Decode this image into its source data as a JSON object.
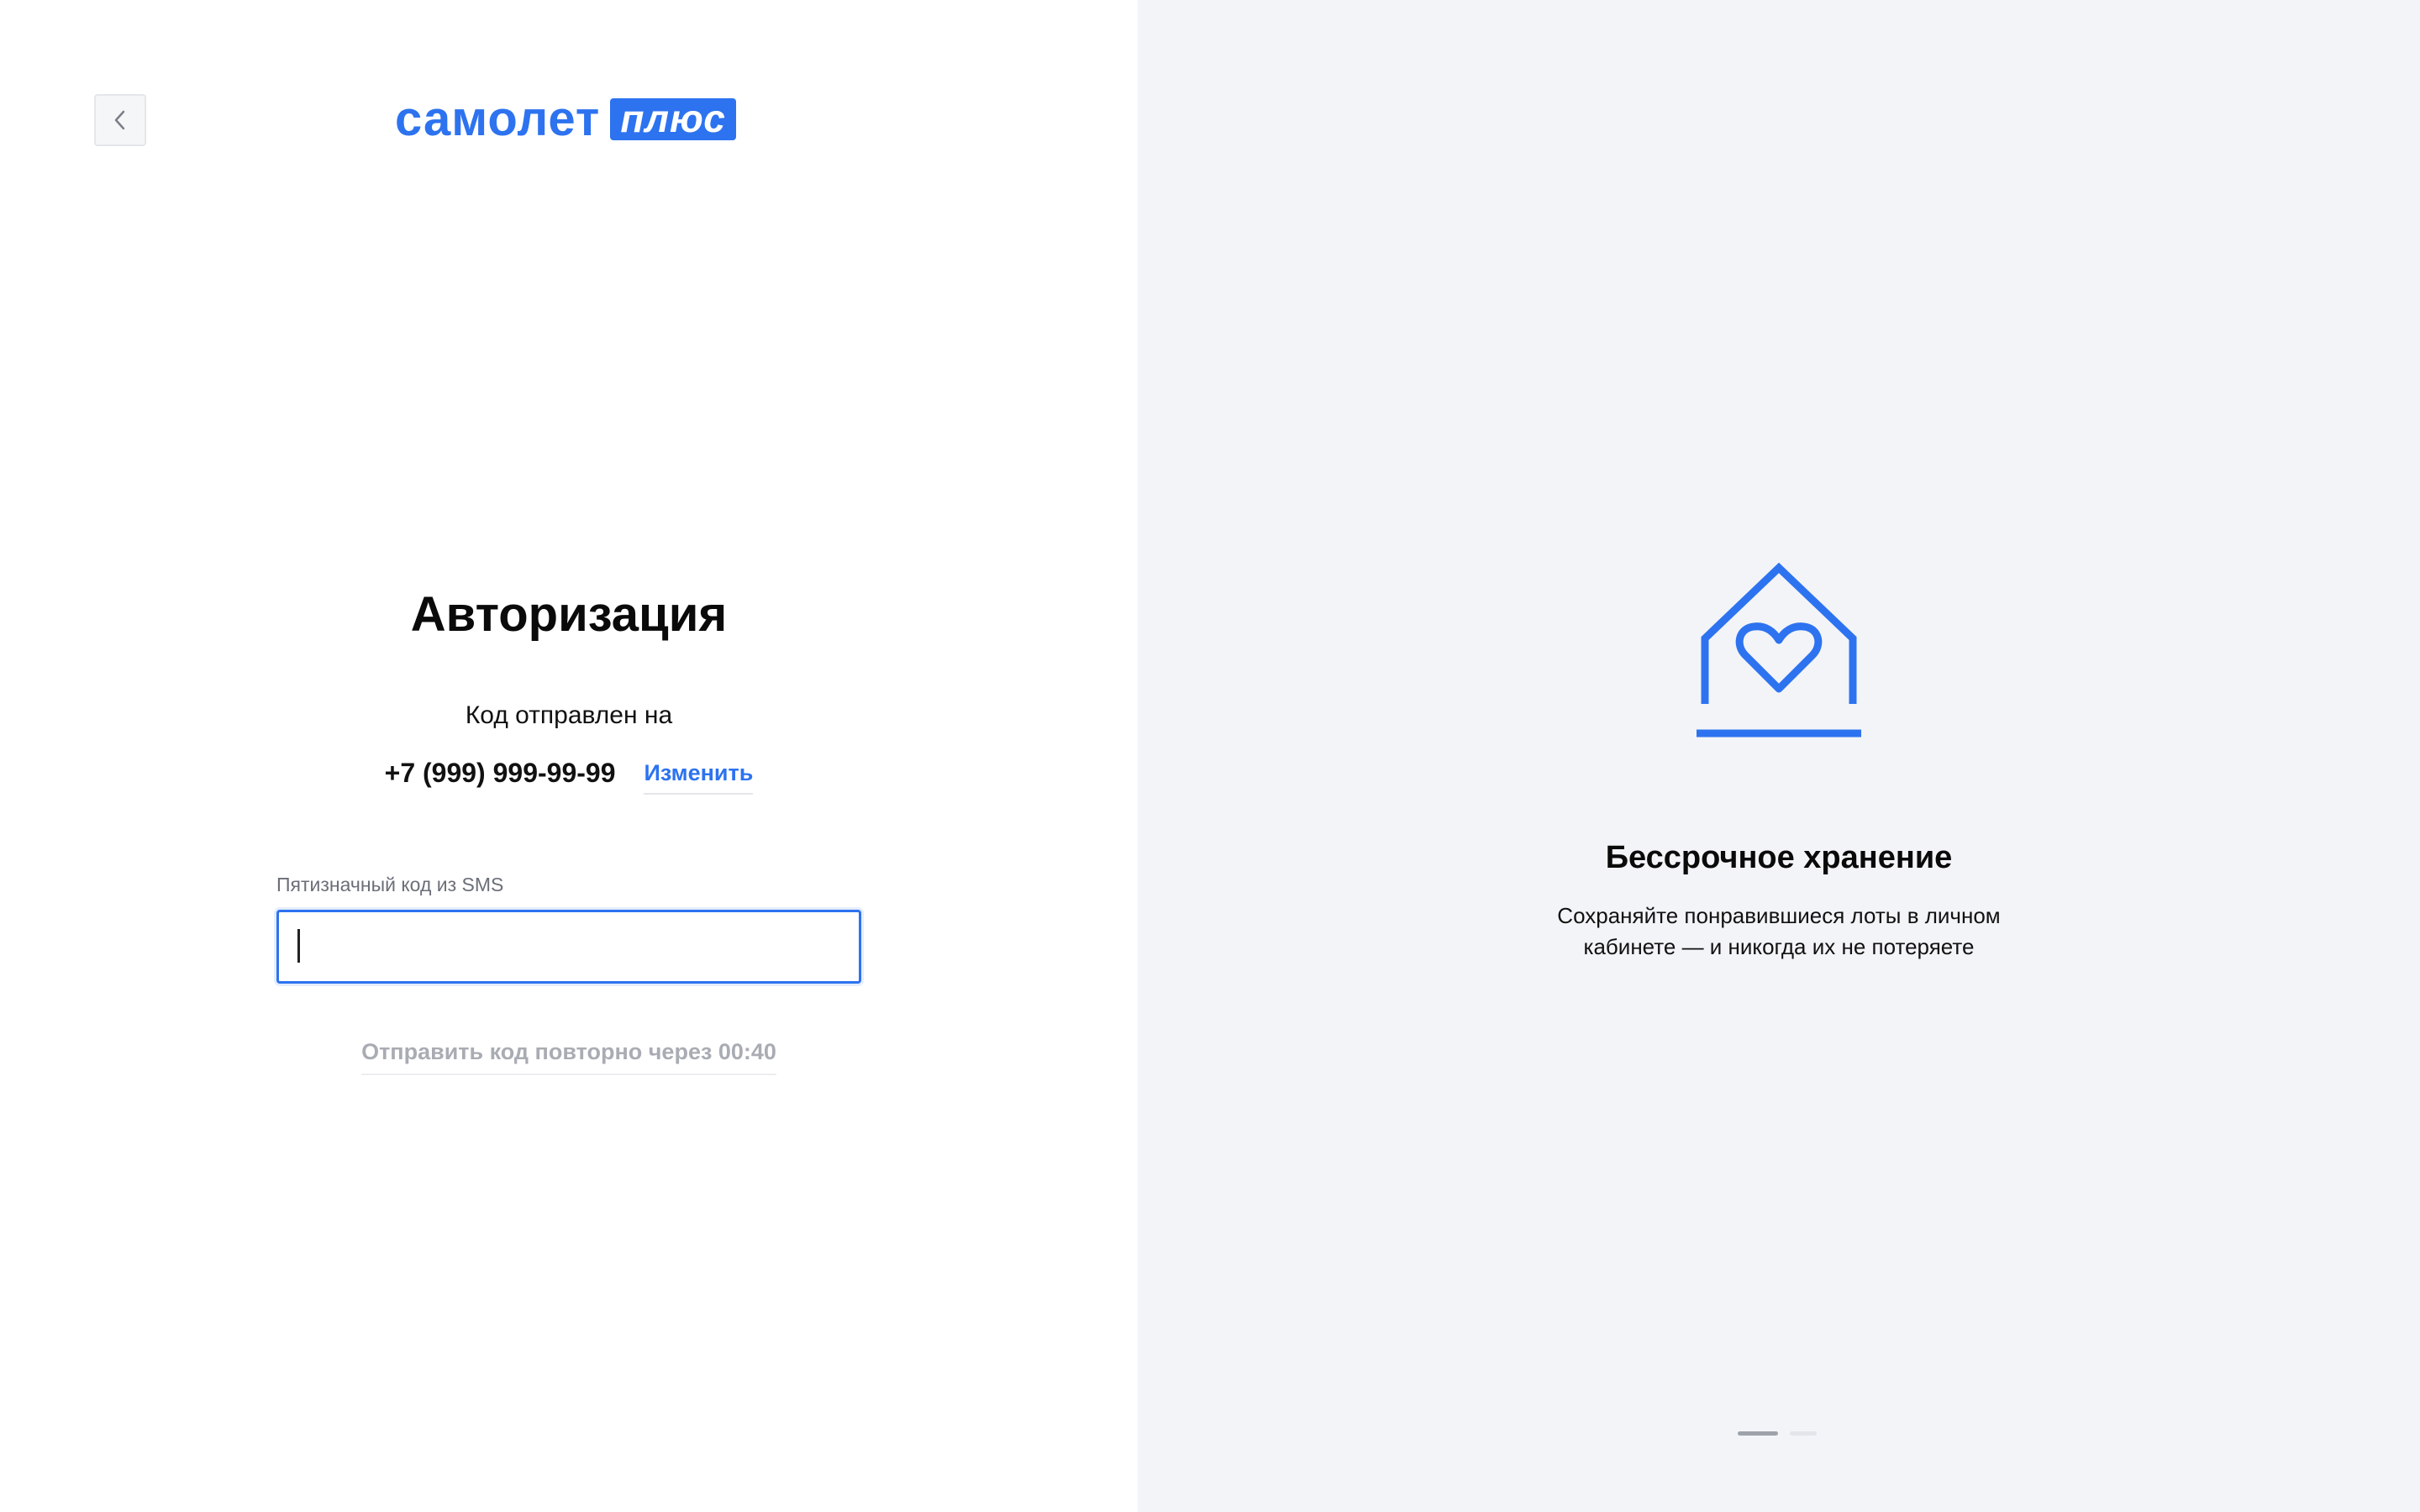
{
  "brand": {
    "word": "самолет",
    "badge": "плюс",
    "accent_color": "#2d73f0"
  },
  "header": {
    "back_icon": "chevron-left-icon"
  },
  "auth": {
    "title": "Авторизация",
    "code_sent_label": "Код отправлен на",
    "phone": "+7 (999) 999-99-99",
    "change_label": "Изменить",
    "code_field": {
      "label": "Пятизначный код из SMS",
      "value": "",
      "placeholder": ""
    },
    "resend_label": "Отправить код повторно через 00:40"
  },
  "promo": {
    "icon": "house-heart-icon",
    "title": "Бессрочное хранение",
    "description": "Сохраняйте понравившиеся лоты в личном кабинете — и никогда их не потеряете",
    "slides_total": 2,
    "active_slide": 1
  },
  "colors": {
    "accent": "#2d73f0",
    "right_panel_bg": "#f3f4f8",
    "muted_text": "#a9acb3"
  }
}
